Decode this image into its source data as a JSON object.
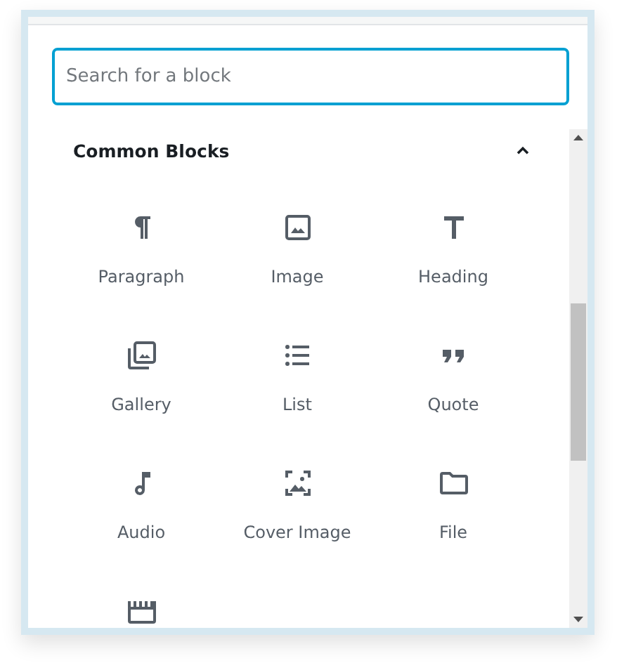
{
  "search": {
    "placeholder": "Search for a block"
  },
  "panel": {
    "title": "Common Blocks",
    "expanded": true,
    "blocks": [
      {
        "kind": "paragraph",
        "label": "Paragraph"
      },
      {
        "kind": "image",
        "label": "Image"
      },
      {
        "kind": "heading",
        "label": "Heading"
      },
      {
        "kind": "gallery",
        "label": "Gallery"
      },
      {
        "kind": "list",
        "label": "List"
      },
      {
        "kind": "quote",
        "label": "Quote"
      },
      {
        "kind": "audio",
        "label": "Audio"
      },
      {
        "kind": "cover",
        "label": "Cover Image"
      },
      {
        "kind": "file",
        "label": "File"
      },
      {
        "kind": "video"
      }
    ]
  }
}
